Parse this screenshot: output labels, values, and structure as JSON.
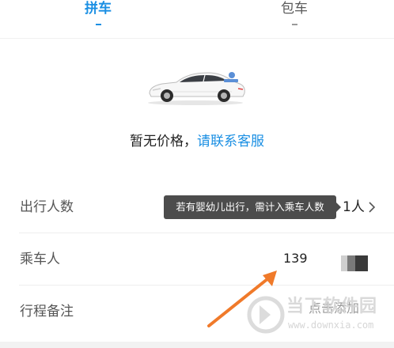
{
  "tabs": [
    {
      "label": "拼车",
      "selected": true
    },
    {
      "label": "包车",
      "selected": false
    }
  ],
  "price": {
    "none_text": "暂无价格，",
    "contact_link": "请联系客服"
  },
  "form": {
    "passenger_count": {
      "label": "出行人数",
      "value": "1人",
      "tooltip": "若有婴幼儿出行，需计入乘车人数"
    },
    "rider": {
      "label": "乘车人",
      "phone": "139"
    },
    "remark": {
      "label": "行程备注",
      "add_label": "点击添加"
    }
  },
  "watermark": {
    "title": "当下软件园",
    "url": "www.downxia.com"
  },
  "colors": {
    "accent": "#1a8fe3",
    "annotation_arrow": "#f07a2a",
    "tooltip_bg": "#4c4c4c"
  },
  "icons": [
    "car-image",
    "chevron-right-icon",
    "arrow-annotation",
    "watermark-logo-icon"
  ]
}
